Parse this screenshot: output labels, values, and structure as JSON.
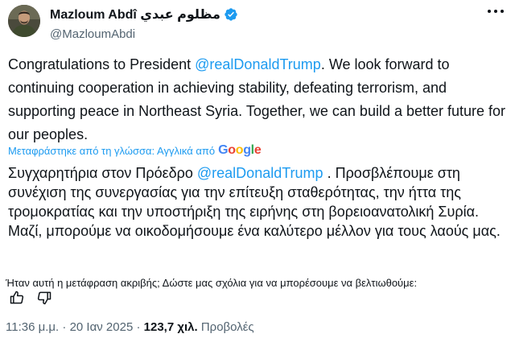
{
  "author": {
    "display_name": "Mazloum Abdî مظلوم عبدي",
    "handle": "@MazloumAbdi"
  },
  "tweet": {
    "text_before": "Congratulations to President ",
    "mention": "@realDonaldTrump",
    "text_after": ". We look forward to continuing cooperation in achieving stability, defeating terrorism, and supporting peace in Northeast Syria. Together, we can build a better future for our peoples."
  },
  "translation": {
    "notice": "Μεταφράστηκε από τη γλώσσα: Αγγλικά από",
    "provider": "Google",
    "text_before": "Συγχαρητήρια στον Πρόεδρο ",
    "mention": "@realDonaldTrump",
    "text_after": " . Προσβλέπουμε στη συνέχιση της συνεργασίας για την επίτευξη σταθερότητας, την ήττα της τρομοκρατίας και την υποστήριξη της ειρήνης στη βορειοανατολική Συρία. Μαζί, μπορούμε να οικοδομήσουμε ένα καλύτερο μέλλον για τους λαούς μας."
  },
  "feedback": {
    "question": "Ήταν αυτή η μετάφραση ακριβής; Δώστε μας σχόλια για να μπορέσουμε να βελτιωθούμε:",
    "thumbs_up_icon": "thumbs-up-icon",
    "thumbs_down_icon": "thumbs-down-icon"
  },
  "meta": {
    "time": "11:36 μ.μ.",
    "separator": "·",
    "date": "20 Ιαν 2025",
    "views_count": "123,7 χιλ.",
    "views_label": "Προβολές"
  },
  "colors": {
    "link": "#1d9bf0",
    "muted": "#536471",
    "text": "#0f1419"
  }
}
